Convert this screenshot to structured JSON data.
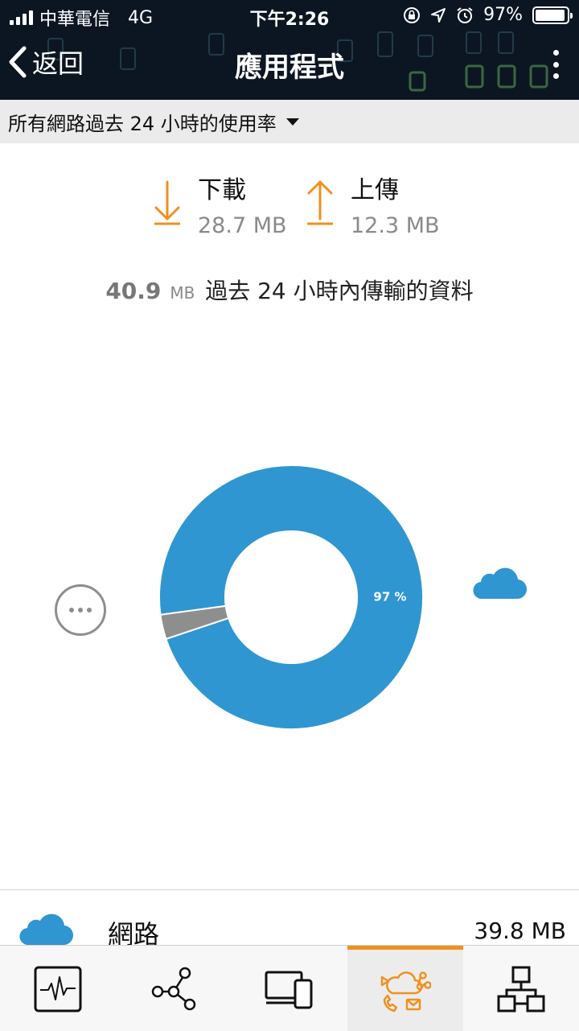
{
  "status_bar": {
    "carrier": "中華電信",
    "network": "4G",
    "time": "下午2:26",
    "battery": "97%",
    "battery_level": 0.97
  },
  "nav": {
    "back_label": "返回",
    "title": "應用程式"
  },
  "filter": {
    "label": "所有網路過去 24 小時的使用率"
  },
  "download": {
    "label": "下載",
    "value": "28.7 MB"
  },
  "upload": {
    "label": "上傳",
    "value": "12.3 MB"
  },
  "summary": {
    "total": "40.9",
    "unit": "MB",
    "text": "過去 24 小時內傳輸的資料"
  },
  "chart_data": {
    "type": "pie",
    "segments": [
      {
        "value": 97,
        "color": "#2f96d1",
        "label": "97 %"
      },
      {
        "value": 3,
        "color": "#8e8e8e"
      }
    ]
  },
  "list": [
    {
      "icon": "cloud-icon",
      "name": "網路",
      "size": "39.8 MB"
    }
  ],
  "tabs": [
    {
      "icon": "activity-monitor-icon",
      "active": false
    },
    {
      "icon": "network-nodes-icon",
      "active": false
    },
    {
      "icon": "devices-icon",
      "active": false
    },
    {
      "icon": "apps-cloud-icon",
      "active": true
    },
    {
      "icon": "topology-icon",
      "active": false
    }
  ],
  "colors": {
    "accent": "#f0901e",
    "chart_blue": "#2f96d1",
    "chart_gray": "#8e8e8e",
    "header_bg": "#0c1622"
  }
}
